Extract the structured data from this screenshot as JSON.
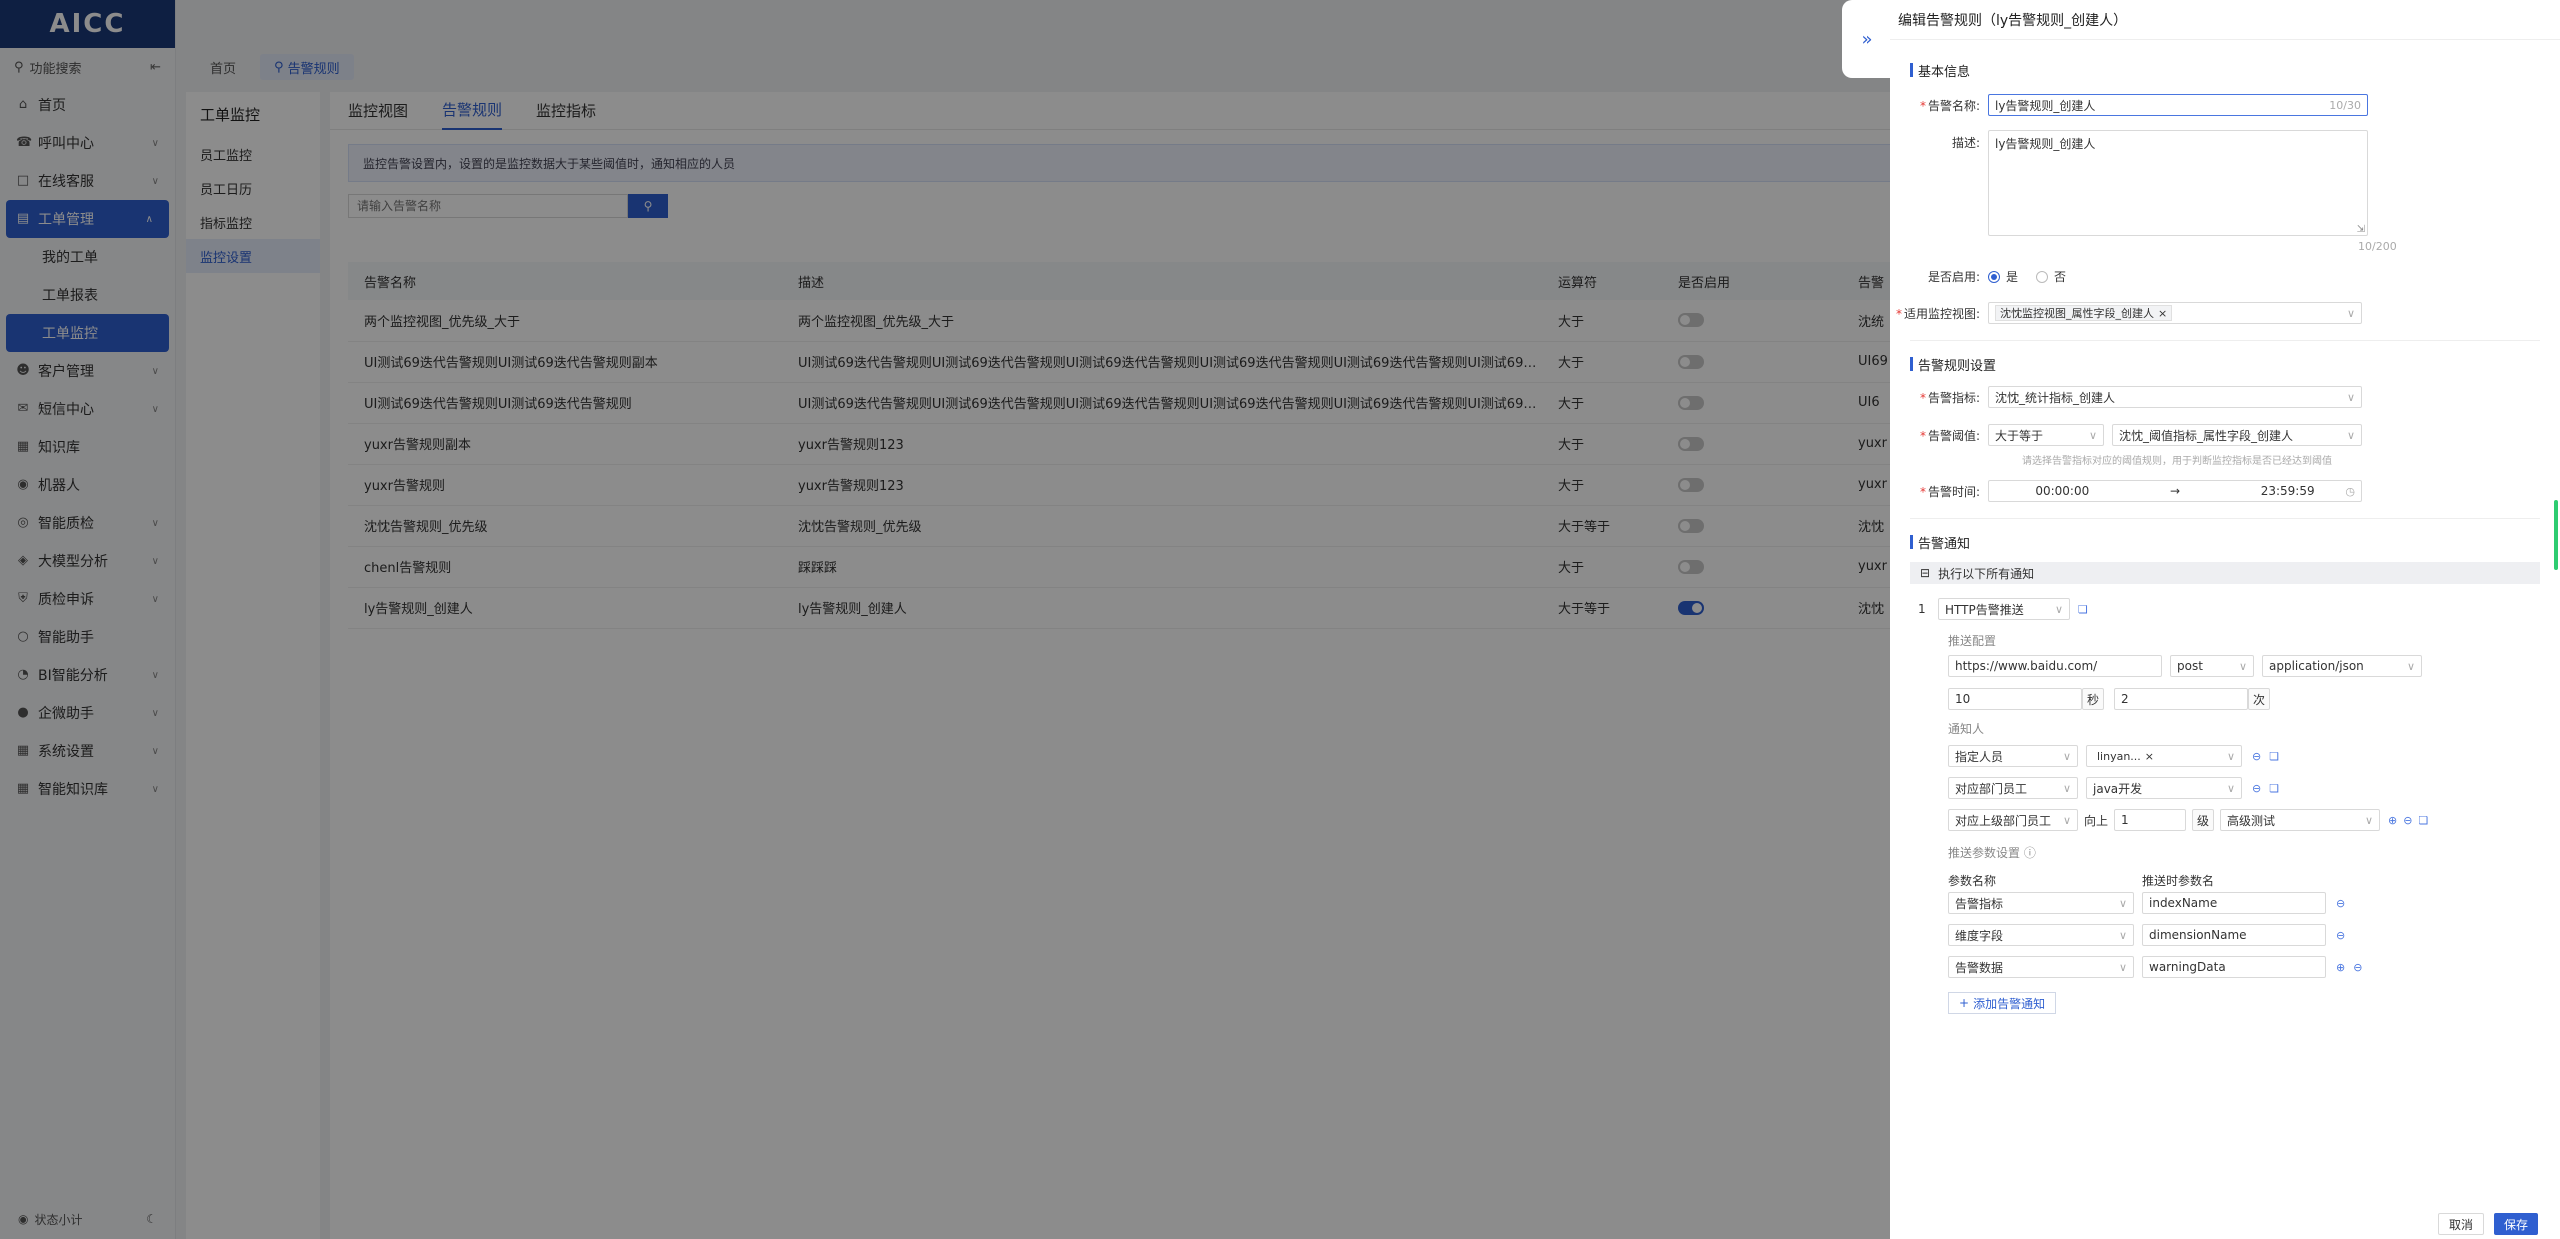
{
  "app": {
    "logo": "AICC"
  },
  "sidebar": {
    "search": "功能搜索",
    "items": [
      {
        "label": "首页",
        "icon": "home-icon"
      },
      {
        "label": "呼叫中心",
        "icon": "phone-icon"
      },
      {
        "label": "在线客服",
        "icon": "chat-icon"
      },
      {
        "label": "工单管理",
        "icon": "ticket-icon"
      },
      {
        "label": "客户管理",
        "icon": "user-icon"
      },
      {
        "label": "短信中心",
        "icon": "sms-icon"
      },
      {
        "label": "知识库",
        "icon": "book-icon"
      },
      {
        "label": "机器人",
        "icon": "robot-icon"
      },
      {
        "label": "智能质检",
        "icon": "check-icon"
      },
      {
        "label": "大模型分析",
        "icon": "model-icon"
      },
      {
        "label": "质检申诉",
        "icon": "shield-icon"
      },
      {
        "label": "智能助手",
        "icon": "assistant-icon"
      },
      {
        "label": "BI智能分析",
        "icon": "chart-icon"
      },
      {
        "label": "企微助手",
        "icon": "wechat-icon"
      },
      {
        "label": "系统设置",
        "icon": "settings-icon"
      },
      {
        "label": "智能知识库",
        "icon": "knowledge-icon"
      }
    ],
    "subitems": [
      "我的工单",
      "工单报表",
      "工单监控"
    ],
    "status": "状态小计"
  },
  "topbar": {
    "tabs": [
      "首页",
      "告警规则"
    ]
  },
  "subside": {
    "title": "工单监控",
    "items": [
      "员工监控",
      "员工日历",
      "指标监控",
      "监控设置"
    ]
  },
  "content": {
    "tabs": [
      "监控视图",
      "告警规则",
      "监控指标"
    ],
    "notice": "监控告警设置内，设置的是监控数据大于某些阈值时，通知相应的人员",
    "search_placeholder": "请输入告警名称",
    "columns": [
      "告警名称",
      "描述",
      "运算符",
      "是否启用",
      "告警"
    ],
    "rows": [
      {
        "name": "两个监控视图_优先级_大于",
        "desc": "两个监控视图_优先级_大于",
        "op": "大于",
        "on": false,
        "extra": "沈统"
      },
      {
        "name": "UI测试69迭代告警规则UI测试69迭代告警规则副本",
        "desc": "UI测试69迭代告警规则UI测试69迭代告警规则UI测试69迭代告警规则UI测试69迭代告警规则UI测试69迭代告警规则UI测试69迭代告警规...",
        "op": "大于",
        "on": false,
        "extra": "UI69"
      },
      {
        "name": "UI测试69迭代告警规则UI测试69迭代告警规则",
        "desc": "UI测试69迭代告警规则UI测试69迭代告警规则UI测试69迭代告警规则UI测试69迭代告警规则UI测试69迭代告警规则UI测试69迭代告警规...",
        "op": "大于",
        "on": false,
        "extra": "UI6"
      },
      {
        "name": "yuxr告警规则副本",
        "desc": "yuxr告警规则123",
        "op": "大于",
        "on": false,
        "extra": "yuxr"
      },
      {
        "name": "yuxr告警规则",
        "desc": "yuxr告警规则123",
        "op": "大于",
        "on": false,
        "extra": "yuxr"
      },
      {
        "name": "沈忱告警规则_优先级",
        "desc": "沈忱告警规则_优先级",
        "op": "大于等于",
        "on": false,
        "extra": "沈忱"
      },
      {
        "name": "chenl告警规则",
        "desc": "踩踩踩",
        "op": "大于",
        "on": false,
        "extra": "yuxr"
      },
      {
        "name": "ly告警规则_创建人",
        "desc": "ly告警规则_创建人",
        "op": "大于等于",
        "on": true,
        "extra": "沈忱"
      }
    ]
  },
  "drawer": {
    "title": "编辑告警规则（ly告警规则_创建人）",
    "basic": {
      "section": "基本信息",
      "name_label": "告警名称:",
      "name_value": "ly告警规则_创建人",
      "name_count": "10/30",
      "desc_label": "描述:",
      "desc_value": "ly告警规则_创建人",
      "desc_count": "10/200",
      "enable_label": "是否启用:",
      "enable_yes": "是",
      "enable_no": "否",
      "view_label": "适用监控视图:",
      "view_tag": "沈忱监控视图_属性字段_创建人"
    },
    "rule": {
      "section": "告警规则设置",
      "metric_label": "告警指标:",
      "metric_value": "沈忱_统计指标_创建人",
      "threshold_label": "告警阈值:",
      "threshold_op": "大于等于",
      "threshold_value": "沈忱_阈值指标_属性字段_创建人",
      "threshold_hint": "请选择告警指标对应的阈值规则，用于判断监控指标是否已经达到阈值",
      "time_label": "告警时间:",
      "time_start": "00:00:00",
      "time_arrow": "→",
      "time_end": "23:59:59"
    },
    "notify": {
      "section": "告警通知",
      "exec_all": "执行以下所有通知",
      "index": "1",
      "type": "HTTP告警推送",
      "push_config": "推送配置",
      "url": "https://www.baidu.com/",
      "method": "post",
      "content_type": "application/json",
      "timeout": "10",
      "timeout_unit": "秒",
      "retry": "2",
      "retry_unit": "次",
      "receivers": "通知人",
      "r1_type": "指定人员",
      "r1_value": "linyan...",
      "r2_type": "对应部门员工",
      "r2_value": "java开发",
      "r3_type": "对应上级部门员工",
      "r3_up": "向上",
      "r3_level": "1",
      "r3_level_unit": "级",
      "r3_value": "高级测试",
      "params_title": "推送参数设置",
      "param_col1": "参数名称",
      "param_col2": "推送时参数名",
      "params": [
        {
          "name": "告警指标",
          "value": "indexName"
        },
        {
          "name": "维度字段",
          "value": "dimensionName"
        },
        {
          "name": "告警数据",
          "value": "warningData"
        }
      ],
      "add_notice": "添加告警通知"
    },
    "footer": {
      "cancel": "取消",
      "save": "保存"
    }
  }
}
